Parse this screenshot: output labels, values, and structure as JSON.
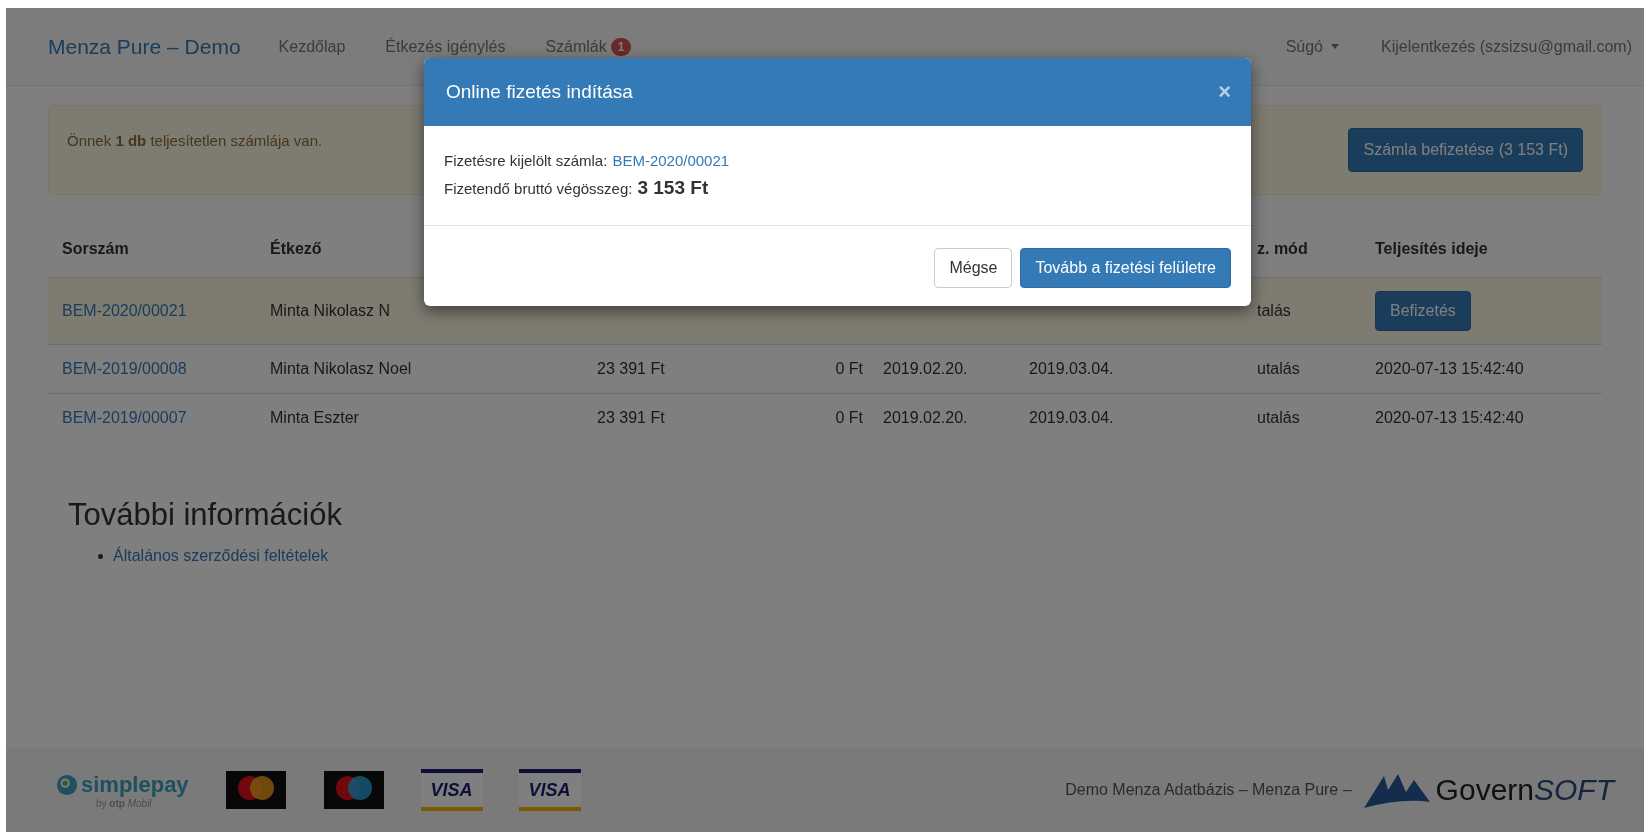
{
  "navbar": {
    "brand": "Menza Pure – Demo",
    "items": [
      {
        "label": "Kezdőlap"
      },
      {
        "label": "Étkezés igénylés"
      },
      {
        "label": "Számlák",
        "badge": "1"
      }
    ],
    "help": {
      "label": "Súgó"
    },
    "logout": "Kijelentkezés (szsizsu@gmail.com)"
  },
  "alert": {
    "text": "Önnek **1 db** teljesítetlen számlája van.",
    "button": "Számla befizetése (3 153 Ft)"
  },
  "table": {
    "columns": [
      {
        "label": "Sorszám"
      },
      {
        "label": "Étkező"
      },
      {
        "label": "z. mód"
      },
      {
        "label": "Teljesítés ideje"
      }
    ],
    "rows": [
      {
        "unpaid": true,
        "number": "BEM-2020/00021",
        "diner": "Minta Nikolasz N",
        "payment_mode": "talás",
        "action": "Befizetés"
      },
      {
        "unpaid": false,
        "number": "BEM-2019/00008",
        "diner": "Minta Nikolasz Noel",
        "column_3": "23 391 Ft",
        "column_4": "0 Ft",
        "column_5": "2019.02.20.",
        "column_6": "2019.03.04.",
        "payment_mode": "utalás",
        "completed": "2020-07-13 15:42:40"
      },
      {
        "unpaid": false,
        "number": "BEM-2019/00007",
        "diner": "Minta Eszter",
        "column_3": "23 391 Ft",
        "column_4": "0 Ft",
        "column_5": "2019.02.20.",
        "column_6": "2019.03.04.",
        "payment_mode": "utalás",
        "completed": "2020-07-13 15:42:40"
      }
    ]
  },
  "info": {
    "heading": "További információk",
    "links": [
      "Általános szerződési feltételek"
    ]
  },
  "footer": {
    "simplepay": {
      "name": "simplepay",
      "by": "by",
      "otp": "otp",
      "mobil": "Mobil"
    },
    "cards": [
      {
        "kind": "mastercard"
      },
      {
        "kind": "maestro"
      },
      {
        "kind": "visa",
        "label": "VISA"
      },
      {
        "kind": "visa",
        "label": "VISA"
      }
    ],
    "text": "Demo Menza Adatbázis – Menza Pure –",
    "vendor": {
      "name": "Govern",
      "suffix": "SOFT"
    }
  },
  "modal": {
    "title": "Online fizetés indítása",
    "close": "×",
    "invoice_label": "Fizetésre kijelölt számla:",
    "invoice_link": "BEM-2020/00021",
    "total_label": "Fizetendő bruttó végösszeg:",
    "total": "3 153 Ft",
    "cancel": "Mégse",
    "proceed": "Tovább a fizetési felületre"
  }
}
